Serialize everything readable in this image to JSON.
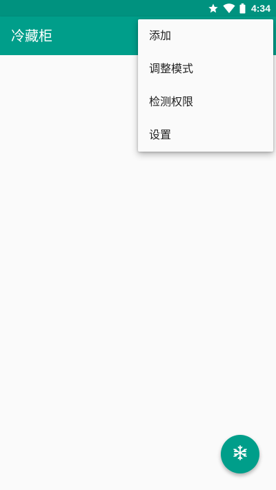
{
  "status_bar": {
    "time": "4:34",
    "icons": [
      "star-icon",
      "wifi-icon",
      "battery-icon"
    ]
  },
  "app_bar": {
    "title": "冷藏柜"
  },
  "overflow_menu": {
    "items": [
      {
        "label": "添加"
      },
      {
        "label": "调整模式"
      },
      {
        "label": "检测权限"
      },
      {
        "label": "设置"
      }
    ]
  },
  "fab": {
    "icon": "snowflake-icon"
  },
  "colors": {
    "primary": "#009e8a",
    "primary_dark": "#00927f",
    "background": "#fafafa",
    "menu_text": "#212121"
  }
}
